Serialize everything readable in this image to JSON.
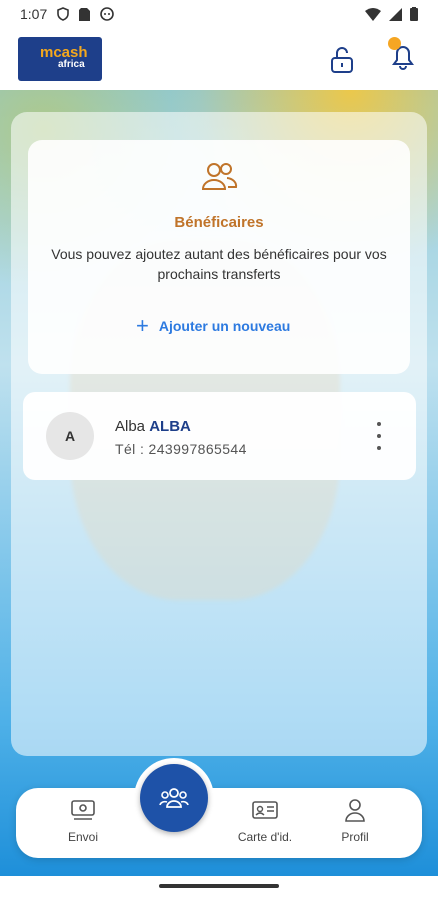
{
  "status_bar": {
    "time": "1:07"
  },
  "header": {
    "logo_brand": "mcash",
    "logo_sub": "africa"
  },
  "card": {
    "title": "Bénéficaires",
    "description": "Vous pouvez ajoutez autant des bénéficaires pour vos prochains transferts",
    "add_label": "Ajouter un nouveau"
  },
  "contacts": [
    {
      "initial": "A",
      "first_name": "Alba",
      "last_name": "ALBA",
      "phone": "Tél : 243997865544"
    }
  ],
  "bottom_nav": {
    "envoi": "Envoi",
    "carte": "Carte d'id.",
    "profil": "Profil"
  },
  "colors": {
    "brand_blue": "#1e3f8a",
    "accent_orange": "#f5a623",
    "link_blue": "#2d7ae0",
    "title_brown": "#c0742a"
  }
}
